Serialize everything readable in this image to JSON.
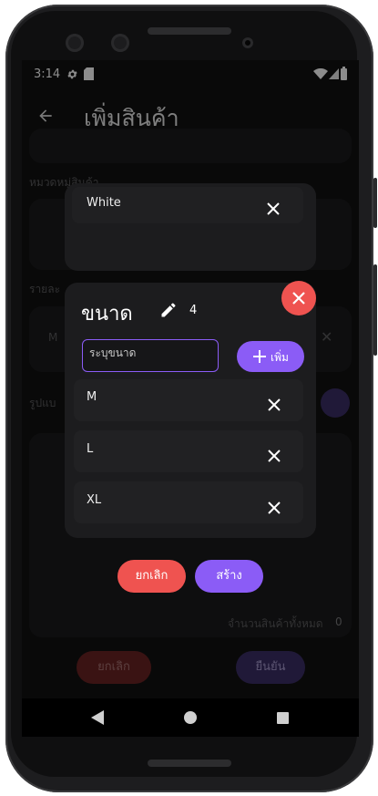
{
  "status_bar": {
    "time": "3:14",
    "icons": [
      "settings-icon",
      "sd-card-icon",
      "wifi-icon",
      "signal-icon",
      "battery-icon"
    ]
  },
  "app_bar": {
    "title": "เพิ่มสินค้า",
    "back_icon": "arrow-left-icon"
  },
  "background_form": {
    "category_label": "หมวดหมู่สินค้า",
    "detail_label": "รายละ",
    "detail_value": "M",
    "image_label": "รูปแบ",
    "total_label": "จำนวนสินค้าทั้งหมด",
    "total_value": "0",
    "cancel_label": "ยกเลิก",
    "confirm_label": "ยืนยัน"
  },
  "color_card": {
    "items": [
      {
        "label": "White"
      }
    ]
  },
  "size_dialog": {
    "title": "ขนาด",
    "count": "4",
    "input_placeholder": "ระบุขนาด",
    "add_label": "เพิ่ม",
    "items": [
      {
        "label": "M"
      },
      {
        "label": "L"
      },
      {
        "label": "XL"
      }
    ],
    "cancel_label": "ยกเลิก",
    "create_label": "สร้าง"
  },
  "colors": {
    "accent": "#8b5cf6",
    "danger": "#ef5350",
    "background": "#121212"
  }
}
